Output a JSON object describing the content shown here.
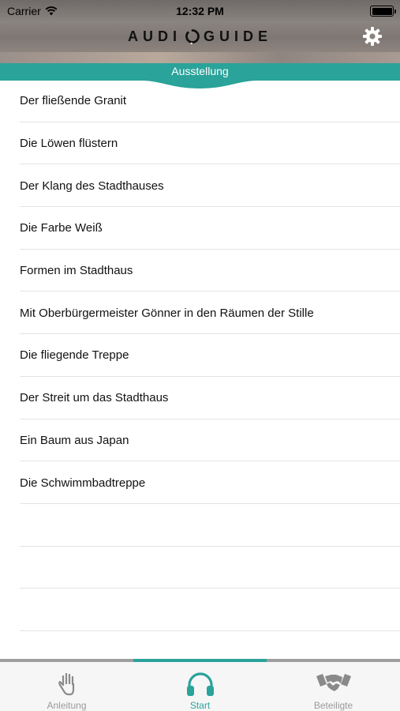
{
  "status_bar": {
    "carrier": "Carrier",
    "time": "12:32 PM"
  },
  "header": {
    "logo_left": "AUDI",
    "logo_right": "GUIDE",
    "settings_icon": "gear-icon"
  },
  "section": {
    "title": "Ausstellung"
  },
  "list": {
    "items": [
      "Der fließende Granit",
      "Die Löwen flüstern",
      "Der Klang des Stadthauses",
      "Die Farbe Weiß",
      "Formen im Stadthaus",
      "Mit Oberbürgermeister Gönner in den Räumen der Stille",
      "Die fliegende Treppe",
      "Der Streit um das Stadthaus",
      "Ein Baum aus Japan",
      "Die Schwimmbadtreppe"
    ]
  },
  "tabbar": {
    "tabs": [
      {
        "label": "Anleitung",
        "icon": "hand-icon",
        "active": false
      },
      {
        "label": "Start",
        "icon": "headphones-icon",
        "active": true
      },
      {
        "label": "Beteiligte",
        "icon": "handshake-icon",
        "active": false
      }
    ]
  },
  "colors": {
    "accent": "#2aa39a",
    "inactive": "#9a9a9a"
  }
}
